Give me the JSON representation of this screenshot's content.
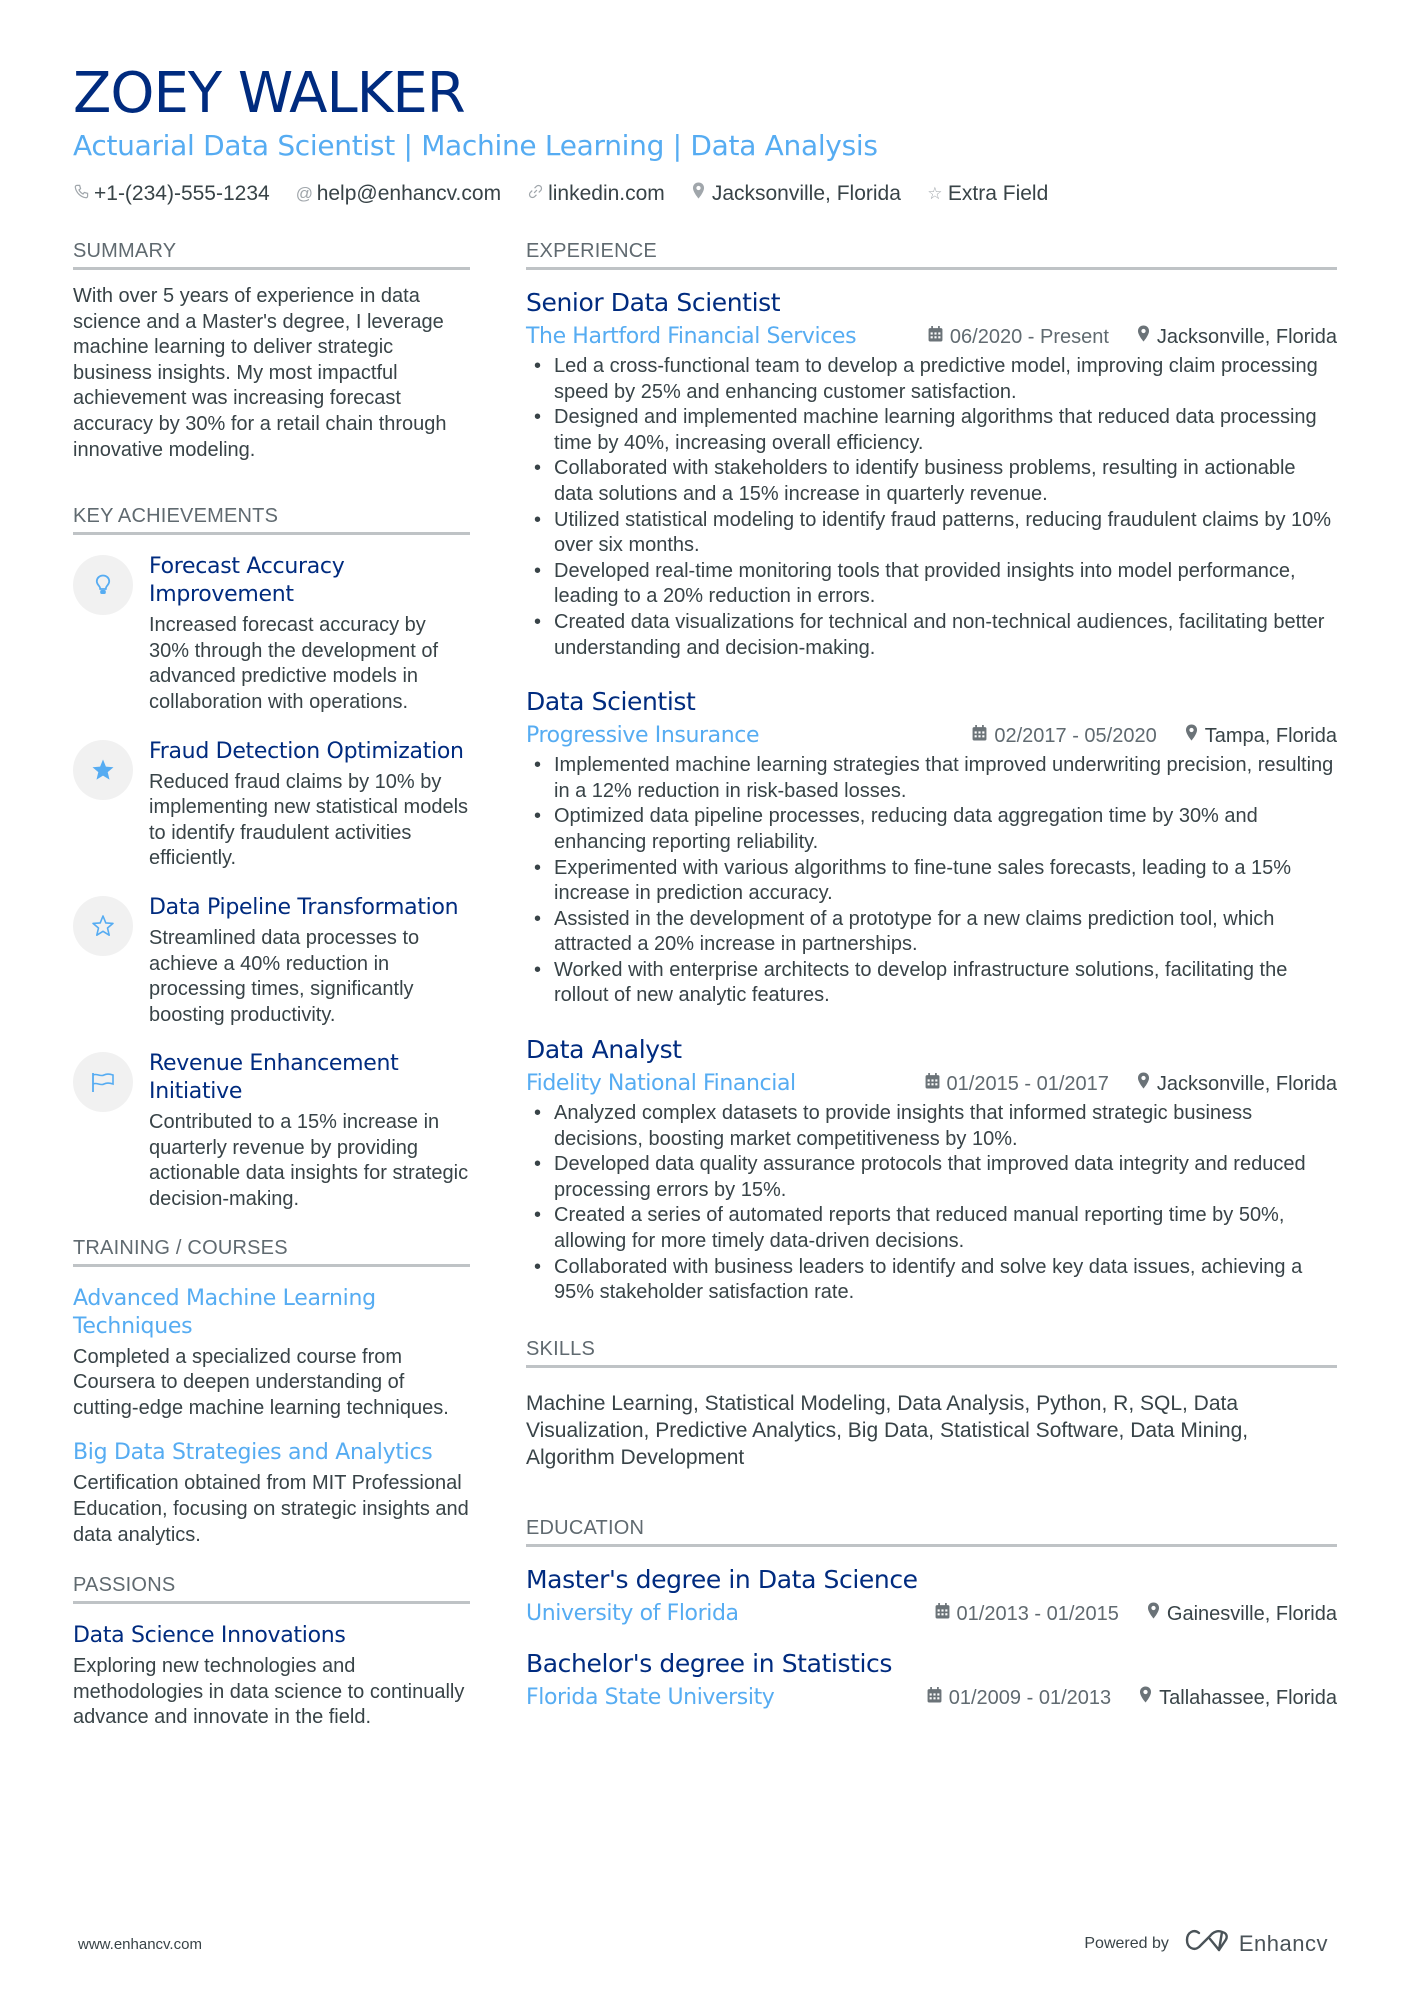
{
  "header": {
    "name": "ZOEY WALKER",
    "headline": "Actuarial Data Scientist | Machine Learning | Data Analysis",
    "contacts": [
      {
        "icon": "phone-icon",
        "glyph": "☎",
        "text": "+1-(234)-555-1234"
      },
      {
        "icon": "at-icon",
        "glyph": "@",
        "text": "help@enhancv.com"
      },
      {
        "icon": "link-icon",
        "glyph": "∞",
        "text": "linkedin.com"
      },
      {
        "icon": "location-pin-icon",
        "glyph": "▼",
        "text": "Jacksonville, Florida"
      },
      {
        "icon": "star-outline-icon",
        "glyph": "☆",
        "text": "Extra Field"
      }
    ]
  },
  "summary": {
    "title": "SUMMARY",
    "text": "With over 5 years of experience in data science and a Master's degree, I leverage machine learning to deliver strategic business insights. My most impactful achievement was increasing forecast accuracy by 30% for a retail chain through innovative modeling."
  },
  "achievements": {
    "title": "KEY ACHIEVEMENTS",
    "items": [
      {
        "icon": "lightbulb-icon",
        "glyph": "💡",
        "title": "Forecast Accuracy Improvement",
        "text": "Increased forecast accuracy by 30% through the development of advanced predictive models in collaboration with operations."
      },
      {
        "icon": "star-filled-icon",
        "glyph": "★",
        "title": "Fraud Detection Optimization",
        "text": "Reduced fraud claims by 10% by implementing new statistical models to identify fraudulent activities efficiently."
      },
      {
        "icon": "star-outline-icon",
        "glyph": "☆",
        "title": "Data Pipeline Transformation",
        "text": "Streamlined data processes to achieve a 40% reduction in processing times, significantly boosting productivity."
      },
      {
        "icon": "flag-icon",
        "glyph": "⚐",
        "title": "Revenue Enhancement Initiative",
        "text": "Contributed to a 15% increase in quarterly revenue by providing actionable data insights for strategic decision-making."
      }
    ]
  },
  "training": {
    "title": "TRAINING / COURSES",
    "items": [
      {
        "title": "Advanced Machine Learning Techniques",
        "text": "Completed a specialized course from Coursera to deepen understanding of cutting-edge machine learning techniques."
      },
      {
        "title": "Big Data Strategies and Analytics",
        "text": "Certification obtained from MIT Professional Education, focusing on strategic insights and data analytics."
      }
    ]
  },
  "passions": {
    "title": "PASSIONS",
    "items": [
      {
        "title": "Data Science Innovations",
        "text": "Exploring new technologies and methodologies in data science to continually advance and innovate in the field."
      }
    ]
  },
  "experience": {
    "title": "EXPERIENCE",
    "jobs": [
      {
        "title": "Senior Data Scientist",
        "company": "The Hartford Financial Services",
        "dates": "06/2020 - Present",
        "location": "Jacksonville, Florida",
        "bullets": [
          "Led a cross-functional team to develop a predictive model, improving claim processing speed by 25% and enhancing customer satisfaction.",
          "Designed and implemented machine learning algorithms that reduced data processing time by 40%, increasing overall efficiency.",
          "Collaborated with stakeholders to identify business problems, resulting in actionable data solutions and a 15% increase in quarterly revenue.",
          "Utilized statistical modeling to identify fraud patterns, reducing fraudulent claims by 10% over six months.",
          "Developed real-time monitoring tools that provided insights into model performance, leading to a 20% reduction in errors.",
          "Created data visualizations for technical and non-technical audiences, facilitating better understanding and decision-making."
        ]
      },
      {
        "title": "Data Scientist",
        "company": "Progressive Insurance",
        "dates": "02/2017 - 05/2020",
        "location": "Tampa, Florida",
        "bullets": [
          "Implemented machine learning strategies that improved underwriting precision, resulting in a 12% reduction in risk-based losses.",
          "Optimized data pipeline processes, reducing data aggregation time by 30% and enhancing reporting reliability.",
          "Experimented with various algorithms to fine-tune sales forecasts, leading to a 15% increase in prediction accuracy.",
          "Assisted in the development of a prototype for a new claims prediction tool, which attracted a 20% increase in partnerships.",
          "Worked with enterprise architects to develop infrastructure solutions, facilitating the rollout of new analytic features."
        ]
      },
      {
        "title": "Data Analyst",
        "company": "Fidelity National Financial",
        "dates": "01/2015 - 01/2017",
        "location": "Jacksonville, Florida",
        "bullets": [
          "Analyzed complex datasets to provide insights that informed strategic business decisions, boosting market competitiveness by 10%.",
          "Developed data quality assurance protocols that improved data integrity and reduced processing errors by 15%.",
          "Created a series of automated reports that reduced manual reporting time by 50%, allowing for more timely data-driven decisions.",
          "Collaborated with business leaders to identify and solve key data issues, achieving a 95% stakeholder satisfaction rate."
        ]
      }
    ]
  },
  "skills": {
    "title": "SKILLS",
    "text": "Machine Learning, Statistical Modeling, Data Analysis, Python, R, SQL, Data Visualization, Predictive Analytics, Big Data, Statistical Software, Data Mining, Algorithm Development"
  },
  "education": {
    "title": "EDUCATION",
    "items": [
      {
        "degree": "Master's degree in Data Science",
        "school": "University of Florida",
        "dates": "01/2013 - 01/2015",
        "location": "Gainesville, Florida"
      },
      {
        "degree": "Bachelor's degree in Statistics",
        "school": "Florida State University",
        "dates": "01/2009 - 01/2013",
        "location": "Tallahassee, Florida"
      }
    ]
  },
  "footer": {
    "url": "www.enhancv.com",
    "powered_by": "Powered by",
    "brand": "Enhancv"
  },
  "icons": {
    "calendar": "▦",
    "pin": "▼"
  }
}
